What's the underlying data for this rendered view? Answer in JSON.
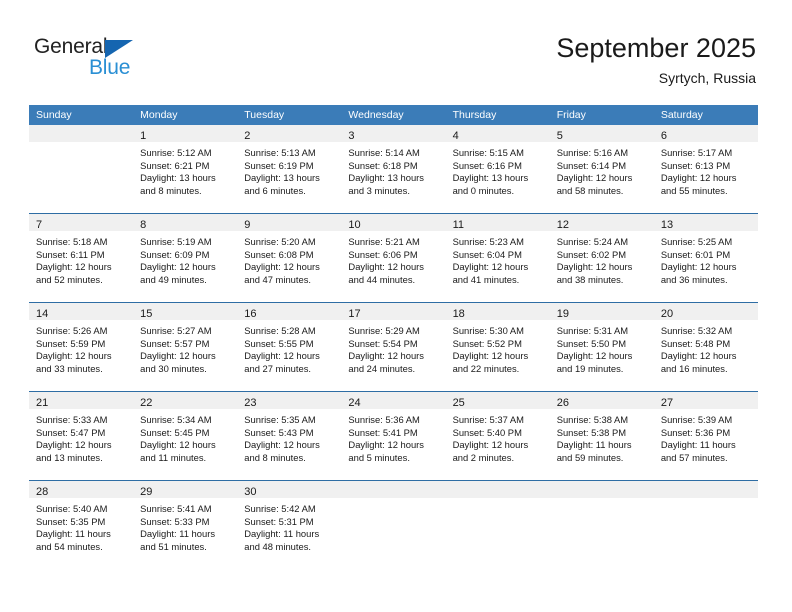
{
  "brand": {
    "name_top": "General",
    "name_bottom": "Blue",
    "accent_color": "#2a8fd4",
    "triangle_color": "#1565b0"
  },
  "header": {
    "title": "September 2025",
    "subtitle": "Syrtych, Russia"
  },
  "theme": {
    "header_bg": "#3b7cb8",
    "row_divider": "#2e6da4",
    "daynum_band_bg": "#f0f0f0",
    "page_bg": "#ffffff"
  },
  "weekdays": [
    "Sunday",
    "Monday",
    "Tuesday",
    "Wednesday",
    "Thursday",
    "Friday",
    "Saturday"
  ],
  "weeks": [
    [
      {
        "day": "",
        "lines": []
      },
      {
        "day": "1",
        "lines": [
          "Sunrise: 5:12 AM",
          "Sunset: 6:21 PM",
          "Daylight: 13 hours",
          "and 8 minutes."
        ]
      },
      {
        "day": "2",
        "lines": [
          "Sunrise: 5:13 AM",
          "Sunset: 6:19 PM",
          "Daylight: 13 hours",
          "and 6 minutes."
        ]
      },
      {
        "day": "3",
        "lines": [
          "Sunrise: 5:14 AM",
          "Sunset: 6:18 PM",
          "Daylight: 13 hours",
          "and 3 minutes."
        ]
      },
      {
        "day": "4",
        "lines": [
          "Sunrise: 5:15 AM",
          "Sunset: 6:16 PM",
          "Daylight: 13 hours",
          "and 0 minutes."
        ]
      },
      {
        "day": "5",
        "lines": [
          "Sunrise: 5:16 AM",
          "Sunset: 6:14 PM",
          "Daylight: 12 hours",
          "and 58 minutes."
        ]
      },
      {
        "day": "6",
        "lines": [
          "Sunrise: 5:17 AM",
          "Sunset: 6:13 PM",
          "Daylight: 12 hours",
          "and 55 minutes."
        ]
      }
    ],
    [
      {
        "day": "7",
        "lines": [
          "Sunrise: 5:18 AM",
          "Sunset: 6:11 PM",
          "Daylight: 12 hours",
          "and 52 minutes."
        ]
      },
      {
        "day": "8",
        "lines": [
          "Sunrise: 5:19 AM",
          "Sunset: 6:09 PM",
          "Daylight: 12 hours",
          "and 49 minutes."
        ]
      },
      {
        "day": "9",
        "lines": [
          "Sunrise: 5:20 AM",
          "Sunset: 6:08 PM",
          "Daylight: 12 hours",
          "and 47 minutes."
        ]
      },
      {
        "day": "10",
        "lines": [
          "Sunrise: 5:21 AM",
          "Sunset: 6:06 PM",
          "Daylight: 12 hours",
          "and 44 minutes."
        ]
      },
      {
        "day": "11",
        "lines": [
          "Sunrise: 5:23 AM",
          "Sunset: 6:04 PM",
          "Daylight: 12 hours",
          "and 41 minutes."
        ]
      },
      {
        "day": "12",
        "lines": [
          "Sunrise: 5:24 AM",
          "Sunset: 6:02 PM",
          "Daylight: 12 hours",
          "and 38 minutes."
        ]
      },
      {
        "day": "13",
        "lines": [
          "Sunrise: 5:25 AM",
          "Sunset: 6:01 PM",
          "Daylight: 12 hours",
          "and 36 minutes."
        ]
      }
    ],
    [
      {
        "day": "14",
        "lines": [
          "Sunrise: 5:26 AM",
          "Sunset: 5:59 PM",
          "Daylight: 12 hours",
          "and 33 minutes."
        ]
      },
      {
        "day": "15",
        "lines": [
          "Sunrise: 5:27 AM",
          "Sunset: 5:57 PM",
          "Daylight: 12 hours",
          "and 30 minutes."
        ]
      },
      {
        "day": "16",
        "lines": [
          "Sunrise: 5:28 AM",
          "Sunset: 5:55 PM",
          "Daylight: 12 hours",
          "and 27 minutes."
        ]
      },
      {
        "day": "17",
        "lines": [
          "Sunrise: 5:29 AM",
          "Sunset: 5:54 PM",
          "Daylight: 12 hours",
          "and 24 minutes."
        ]
      },
      {
        "day": "18",
        "lines": [
          "Sunrise: 5:30 AM",
          "Sunset: 5:52 PM",
          "Daylight: 12 hours",
          "and 22 minutes."
        ]
      },
      {
        "day": "19",
        "lines": [
          "Sunrise: 5:31 AM",
          "Sunset: 5:50 PM",
          "Daylight: 12 hours",
          "and 19 minutes."
        ]
      },
      {
        "day": "20",
        "lines": [
          "Sunrise: 5:32 AM",
          "Sunset: 5:48 PM",
          "Daylight: 12 hours",
          "and 16 minutes."
        ]
      }
    ],
    [
      {
        "day": "21",
        "lines": [
          "Sunrise: 5:33 AM",
          "Sunset: 5:47 PM",
          "Daylight: 12 hours",
          "and 13 minutes."
        ]
      },
      {
        "day": "22",
        "lines": [
          "Sunrise: 5:34 AM",
          "Sunset: 5:45 PM",
          "Daylight: 12 hours",
          "and 11 minutes."
        ]
      },
      {
        "day": "23",
        "lines": [
          "Sunrise: 5:35 AM",
          "Sunset: 5:43 PM",
          "Daylight: 12 hours",
          "and 8 minutes."
        ]
      },
      {
        "day": "24",
        "lines": [
          "Sunrise: 5:36 AM",
          "Sunset: 5:41 PM",
          "Daylight: 12 hours",
          "and 5 minutes."
        ]
      },
      {
        "day": "25",
        "lines": [
          "Sunrise: 5:37 AM",
          "Sunset: 5:40 PM",
          "Daylight: 12 hours",
          "and 2 minutes."
        ]
      },
      {
        "day": "26",
        "lines": [
          "Sunrise: 5:38 AM",
          "Sunset: 5:38 PM",
          "Daylight: 11 hours",
          "and 59 minutes."
        ]
      },
      {
        "day": "27",
        "lines": [
          "Sunrise: 5:39 AM",
          "Sunset: 5:36 PM",
          "Daylight: 11 hours",
          "and 57 minutes."
        ]
      }
    ],
    [
      {
        "day": "28",
        "lines": [
          "Sunrise: 5:40 AM",
          "Sunset: 5:35 PM",
          "Daylight: 11 hours",
          "and 54 minutes."
        ]
      },
      {
        "day": "29",
        "lines": [
          "Sunrise: 5:41 AM",
          "Sunset: 5:33 PM",
          "Daylight: 11 hours",
          "and 51 minutes."
        ]
      },
      {
        "day": "30",
        "lines": [
          "Sunrise: 5:42 AM",
          "Sunset: 5:31 PM",
          "Daylight: 11 hours",
          "and 48 minutes."
        ]
      },
      {
        "day": "",
        "lines": []
      },
      {
        "day": "",
        "lines": []
      },
      {
        "day": "",
        "lines": []
      },
      {
        "day": "",
        "lines": []
      }
    ]
  ]
}
